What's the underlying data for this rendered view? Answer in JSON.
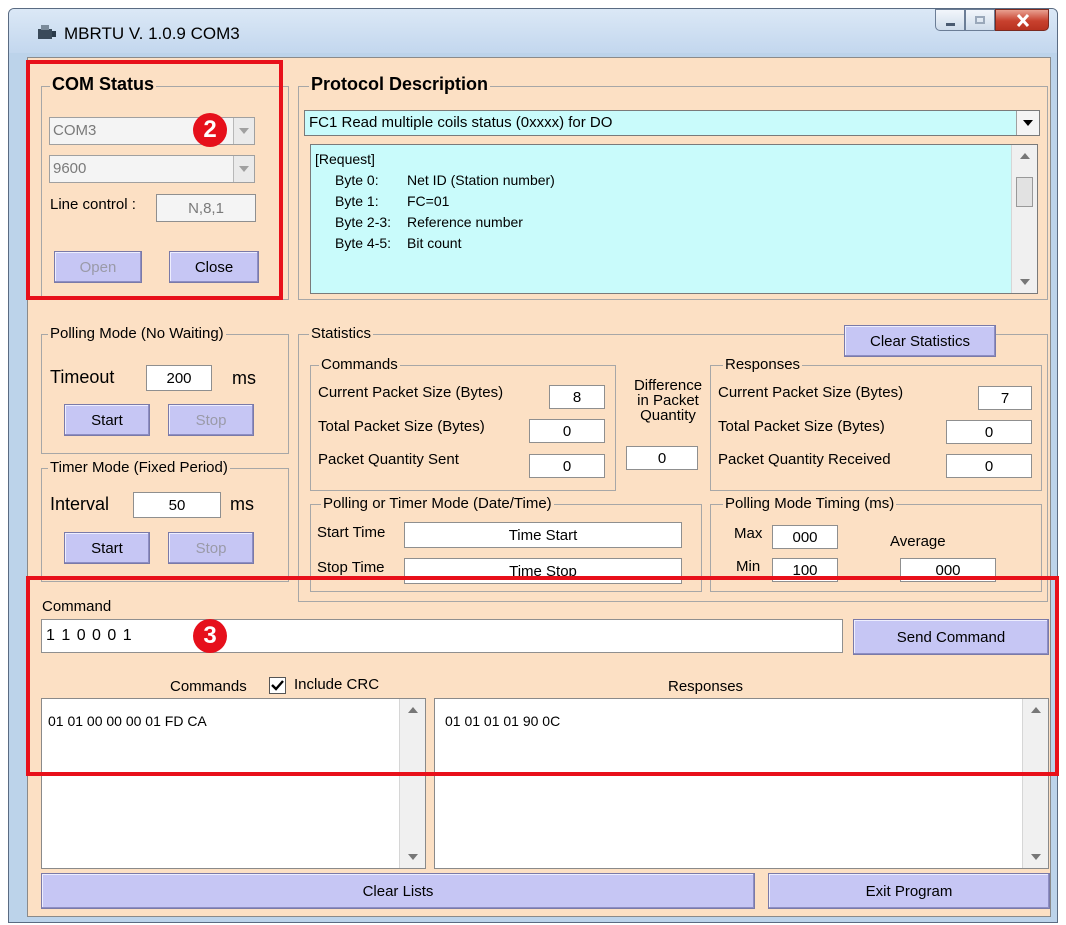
{
  "window": {
    "title": "MBRTU V. 1.0.9 COM3"
  },
  "com_status": {
    "legend": "COM Status",
    "port": "COM3",
    "baud": "9600",
    "line_control_label": "Line control :",
    "line_control_value": "N,8,1",
    "open_label": "Open",
    "close_label": "Close"
  },
  "protocol": {
    "legend": "Protocol Description",
    "selected": "FC1  Read multiple coils status (0xxxx)  for DO",
    "description_lines": [
      {
        "label": "[Request]",
        "value": ""
      },
      {
        "label": "Byte 0:",
        "value": "Net ID (Station number)"
      },
      {
        "label": "Byte 1:",
        "value": "FC=01"
      },
      {
        "label": "Byte 2-3:",
        "value": "Reference number"
      },
      {
        "label": "Byte 4-5:",
        "value": "Bit count"
      }
    ]
  },
  "polling": {
    "legend": "Polling Mode (No Waiting)",
    "timeout_label": "Timeout",
    "timeout_value": "200",
    "unit": "ms",
    "start_label": "Start",
    "stop_label": "Stop"
  },
  "timer": {
    "legend": "Timer Mode (Fixed Period)",
    "interval_label": "Interval",
    "interval_value": "50",
    "unit": "ms",
    "start_label": "Start",
    "stop_label": "Stop"
  },
  "statistics": {
    "legend": "Statistics",
    "clear_label": "Clear Statistics",
    "commands": {
      "legend": "Commands",
      "current_label": "Current Packet Size (Bytes)",
      "current_value": "8",
      "total_label": "Total Packet Size (Bytes)",
      "total_value": "0",
      "qty_label": "Packet Quantity Sent",
      "qty_value": "0"
    },
    "difference": {
      "line1": "Difference",
      "line2": "in Packet",
      "line3": "Quantity",
      "value": "0"
    },
    "responses": {
      "legend": "Responses",
      "current_label": "Current Packet Size (Bytes)",
      "current_value": "7",
      "total_label": "Total Packet Size (Bytes)",
      "total_value": "0",
      "qty_label": "Packet Quantity Received",
      "qty_value": "0"
    },
    "datetime": {
      "legend": "Polling  or Timer Mode  (Date/Time)",
      "start_label": "Start Time",
      "start_value": "Time Start",
      "stop_label": "Stop Time",
      "stop_value": "Time Stop"
    },
    "timing": {
      "legend": "Polling Mode Timing (ms)",
      "max_label": "Max",
      "max_value": "000",
      "min_label": "Min",
      "min_value": "100",
      "avg_label": "Average",
      "avg_value": "000"
    }
  },
  "command": {
    "label": "Command",
    "value": "1 1 0 0 0 1",
    "send_label": "Send Command",
    "commands_header": "Commands",
    "include_crc_label": "Include CRC",
    "responses_header": "Responses",
    "commands_list": [
      "01 01 00 00 00 01 FD CA"
    ],
    "responses_list": [
      "01 01 01 01 90 0C"
    ]
  },
  "footer": {
    "clear_lists_label": "Clear Lists",
    "exit_label": "Exit Program"
  },
  "annotations": {
    "badge_2": "2",
    "badge_3": "3",
    "highlight_color": "#e8101a"
  }
}
